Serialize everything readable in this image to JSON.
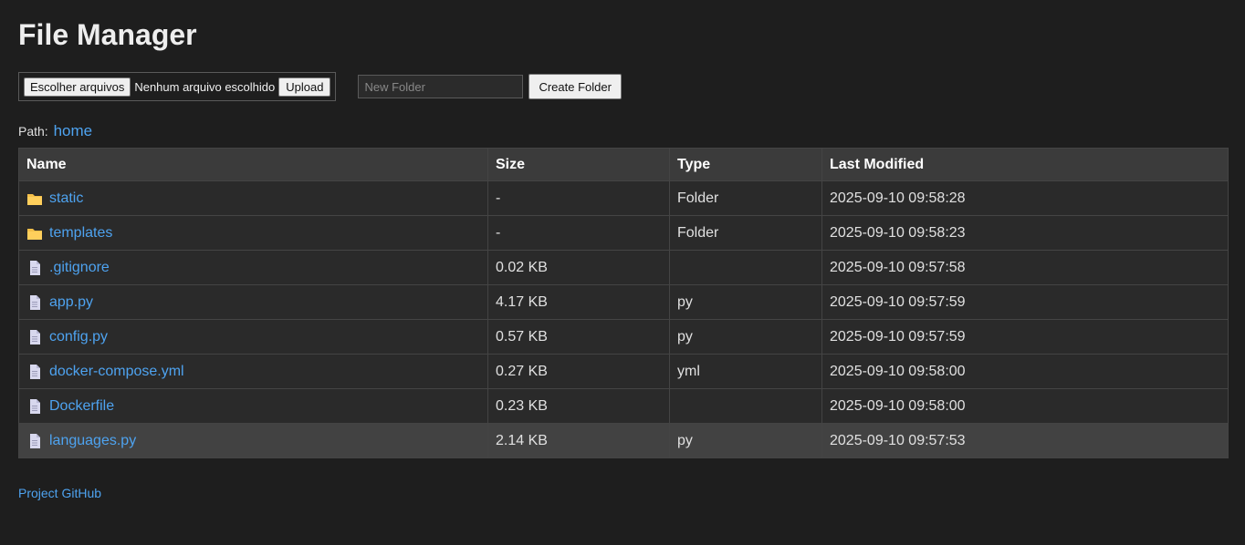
{
  "title": "File Manager",
  "upload": {
    "choose_label": "Escolher arquivos",
    "status": "Nenhum arquivo escolhido",
    "upload_label": "Upload"
  },
  "folder": {
    "placeholder": "New Folder",
    "create_label": "Create Folder"
  },
  "path": {
    "label": "Path:",
    "crumb": "home"
  },
  "table": {
    "headers": [
      "Name",
      "Size",
      "Type",
      "Last Modified"
    ],
    "rows": [
      {
        "icon": "folder-icon",
        "name": "static",
        "size": "-",
        "type": "Folder",
        "modified": "2025-09-10 09:58:28"
      },
      {
        "icon": "folder-icon",
        "name": "templates",
        "size": "-",
        "type": "Folder",
        "modified": "2025-09-10 09:58:23"
      },
      {
        "icon": "file-icon",
        "name": ".gitignore",
        "size": "0.02 KB",
        "type": "",
        "modified": "2025-09-10 09:57:58"
      },
      {
        "icon": "file-icon",
        "name": "app.py",
        "size": "4.17 KB",
        "type": "py",
        "modified": "2025-09-10 09:57:59"
      },
      {
        "icon": "file-icon",
        "name": "config.py",
        "size": "0.57 KB",
        "type": "py",
        "modified": "2025-09-10 09:57:59"
      },
      {
        "icon": "file-icon",
        "name": "docker-compose.yml",
        "size": "0.27 KB",
        "type": "yml",
        "modified": "2025-09-10 09:58:00"
      },
      {
        "icon": "file-icon",
        "name": "Dockerfile",
        "size": "0.23 KB",
        "type": "",
        "modified": "2025-09-10 09:58:00"
      },
      {
        "icon": "file-icon",
        "name": "languages.py",
        "size": "2.14 KB",
        "type": "py",
        "modified": "2025-09-10 09:57:53"
      }
    ]
  },
  "footer": {
    "link": "Project GitHub"
  },
  "colors": {
    "background": "#1e1e1e",
    "link": "#4ea3f0",
    "folder": "#f5c04a",
    "file": "#d8d8ee",
    "highlight_row": "#424242"
  }
}
